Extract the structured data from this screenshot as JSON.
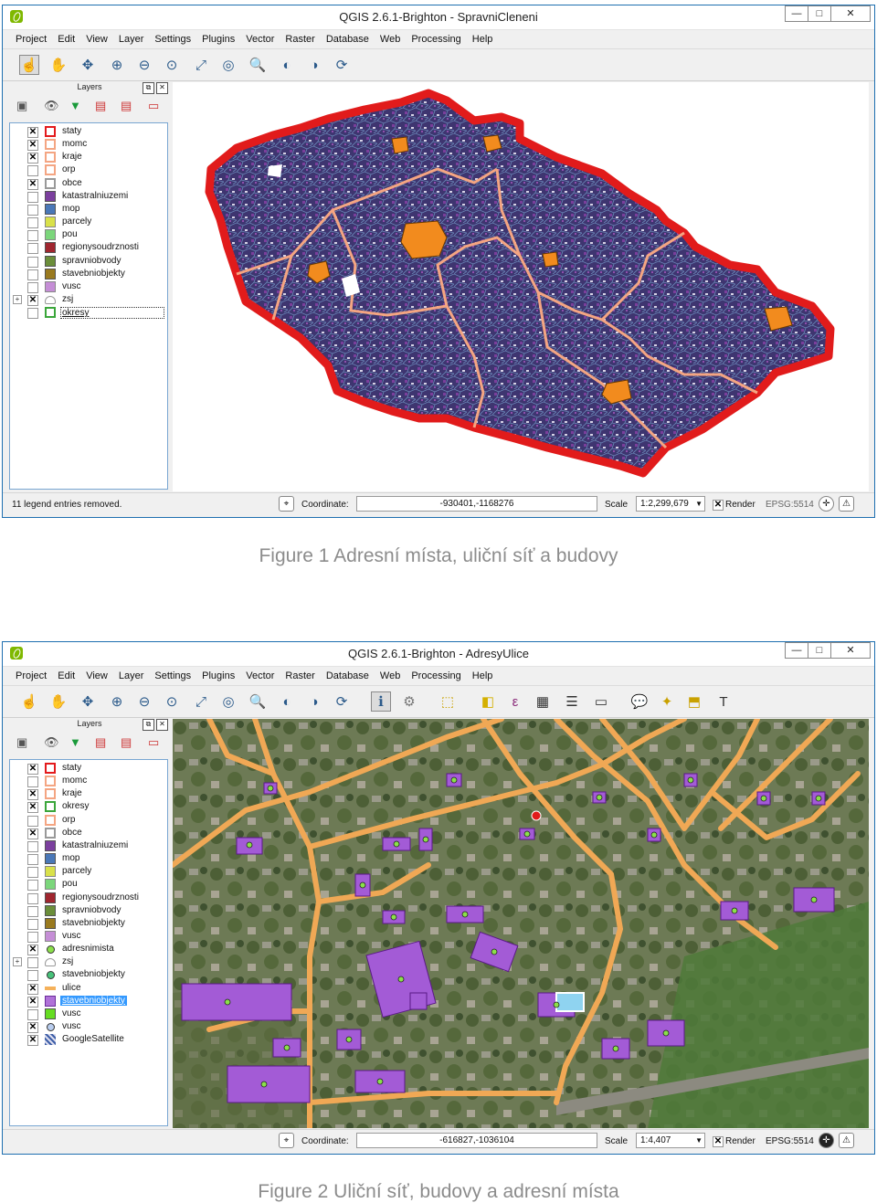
{
  "menu": [
    "Project",
    "Edit",
    "View",
    "Layer",
    "Settings",
    "Plugins",
    "Vector",
    "Raster",
    "Database",
    "Web",
    "Processing",
    "Help"
  ],
  "window_controls": {
    "minimize": "—",
    "maximize": "□",
    "close": "✕"
  },
  "panel_title": "Layers",
  "window1": {
    "title": "QGIS 2.6.1-Brighton - SpravniCleneni",
    "layers": [
      {
        "name": "staty",
        "checked": true,
        "sym_fill": "#ffffff",
        "sym_border": "#e31a1c"
      },
      {
        "name": "momc",
        "checked": true,
        "sym_fill": "#ffffff",
        "sym_border": "#f4a582"
      },
      {
        "name": "kraje",
        "checked": true,
        "sym_fill": "#ffffff",
        "sym_border": "#f4a582"
      },
      {
        "name": "orp",
        "checked": false,
        "sym_fill": "#ffffff",
        "sym_border": "#f4a582"
      },
      {
        "name": "obce",
        "checked": true,
        "sym_fill": "#ffffff",
        "sym_border": "#999999"
      },
      {
        "name": "katastralniuzemi",
        "checked": false,
        "sym_fill": "#7b3f9e",
        "sym_border": "#555"
      },
      {
        "name": "mop",
        "checked": false,
        "sym_fill": "#4a78b8",
        "sym_border": "#555"
      },
      {
        "name": "parcely",
        "checked": false,
        "sym_fill": "#d9e14a",
        "sym_border": "#888"
      },
      {
        "name": "pou",
        "checked": false,
        "sym_fill": "#7bd67b",
        "sym_border": "#888"
      },
      {
        "name": "regionysoudrznosti",
        "checked": false,
        "sym_fill": "#a0262f",
        "sym_border": "#555"
      },
      {
        "name": "spravniobvody",
        "checked": false,
        "sym_fill": "#6b8e3a",
        "sym_border": "#555"
      },
      {
        "name": "stavebniobjekty",
        "checked": false,
        "sym_fill": "#9a7a1f",
        "sym_border": "#555"
      },
      {
        "name": "vusc",
        "checked": false,
        "sym_fill": "#c58ed6",
        "sym_border": "#888"
      },
      {
        "name": "zsj",
        "checked": true,
        "group": true,
        "sym_fill": "#ffffff",
        "sym_border": "#888"
      },
      {
        "name": "okresy",
        "checked": false,
        "boxed": true,
        "sym_fill": "#ffffff",
        "sym_border": "#3aa63a"
      }
    ],
    "status_message": "11 legend entries removed.",
    "coordinate_label": "Coordinate:",
    "coordinate": "-930401,-1168276",
    "scale_label": "Scale",
    "scale": "1:2,299,679",
    "render_label": "Render",
    "epsg": "EPSG:5514"
  },
  "caption1": "Figure 1 Adresní místa, uliční síť a budovy",
  "window2": {
    "title": "QGIS 2.6.1-Brighton - AdresyUlice",
    "layers": [
      {
        "name": "staty",
        "checked": true,
        "sym_fill": "#ffffff",
        "sym_border": "#e31a1c"
      },
      {
        "name": "momc",
        "checked": false,
        "sym_fill": "#ffffff",
        "sym_border": "#f4a582"
      },
      {
        "name": "kraje",
        "checked": true,
        "sym_fill": "#ffffff",
        "sym_border": "#f4a582"
      },
      {
        "name": "okresy",
        "checked": true,
        "sym_fill": "#ffffff",
        "sym_border": "#3aa63a"
      },
      {
        "name": "orp",
        "checked": false,
        "sym_fill": "#ffffff",
        "sym_border": "#f4a582"
      },
      {
        "name": "obce",
        "checked": true,
        "sym_fill": "#ffffff",
        "sym_border": "#999999"
      },
      {
        "name": "katastralniuzemi",
        "checked": false,
        "sym_fill": "#7b3f9e",
        "sym_border": "#555"
      },
      {
        "name": "mop",
        "checked": false,
        "sym_fill": "#4a78b8",
        "sym_border": "#555"
      },
      {
        "name": "parcely",
        "checked": false,
        "sym_fill": "#d9e14a",
        "sym_border": "#888"
      },
      {
        "name": "pou",
        "checked": false,
        "sym_fill": "#7bd67b",
        "sym_border": "#888"
      },
      {
        "name": "regionysoudrznosti",
        "checked": false,
        "sym_fill": "#a0262f",
        "sym_border": "#555"
      },
      {
        "name": "spravniobvody",
        "checked": false,
        "sym_fill": "#6b8e3a",
        "sym_border": "#555"
      },
      {
        "name": "stavebniobjekty",
        "checked": false,
        "sym_fill": "#9a7a1f",
        "sym_border": "#555"
      },
      {
        "name": "vusc",
        "checked": false,
        "sym_fill": "#c58ed6",
        "sym_border": "#888"
      },
      {
        "name": "adresnimista",
        "checked": true,
        "point": true,
        "sym_fill": "#8be04a",
        "sym_border": "#333"
      },
      {
        "name": "zsj",
        "checked": false,
        "group": true,
        "sym_fill": "#ffffff",
        "sym_border": "#888"
      },
      {
        "name": "stavebniobjekty",
        "checked": false,
        "point": true,
        "sym_fill": "#47c27a",
        "sym_border": "#333"
      },
      {
        "name": "ulice",
        "checked": true,
        "line": true,
        "sym_fill": "#f5b15a",
        "sym_border": "#f5b15a"
      },
      {
        "name": "stavebniobjekty",
        "checked": true,
        "selected": true,
        "sym_fill": "#b072d8",
        "sym_border": "#6a2d9a"
      },
      {
        "name": "vusc",
        "checked": false,
        "sym_fill": "#66dd22",
        "sym_border": "#555"
      },
      {
        "name": "vusc",
        "checked": true,
        "point": true,
        "sym_fill": "#b9cdee",
        "sym_border": "#333"
      },
      {
        "name": "GoogleSatellite",
        "checked": true,
        "raster": true,
        "sym_fill": "#3d5fa8",
        "sym_border": "#3d5fa8"
      }
    ],
    "status_message": "",
    "coordinate_label": "Coordinate:",
    "coordinate": "-616827,-1036104",
    "scale_label": "Scale",
    "scale": "1:4,407",
    "render_label": "Render",
    "epsg": "EPSG:5514"
  },
  "caption2": "Figure 2 Uliční síť, budovy a adresní místa"
}
